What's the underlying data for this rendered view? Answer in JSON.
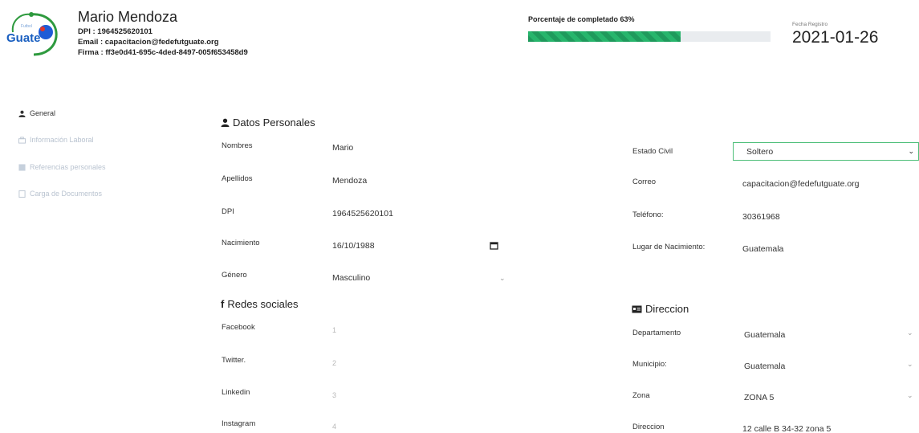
{
  "header": {
    "name": "Mario Mendoza",
    "dpi_label": "DPI :",
    "dpi_value": "1964525620101",
    "email_label": "Email :",
    "email_value": "capacitacion@fedefutguate.org",
    "firma_label": "Firma :",
    "firma_value": "ff3e0d41-695c-4ded-8497-005f653458d9",
    "logo_text": "Guate",
    "logo_small_text": "Futbol"
  },
  "progress": {
    "label": "Porcentaje de completado 63%",
    "percent": 63,
    "color": "#1f9a5c"
  },
  "registration": {
    "label": "Fecha Registro",
    "date": "2021-01-26"
  },
  "sidebar": {
    "items": [
      {
        "label": "General",
        "icon": "user-icon",
        "active": true
      },
      {
        "label": "Información Laboral",
        "icon": "briefcase-icon",
        "active": false
      },
      {
        "label": "Referencias personales",
        "icon": "users-icon",
        "active": false
      },
      {
        "label": "Carga de Documentos",
        "icon": "document-icon",
        "active": false
      }
    ]
  },
  "personal": {
    "title": "Datos Personales",
    "nombres_label": "Nombres",
    "nombres_value": "Mario",
    "apellidos_label": "Apellidos",
    "apellidos_value": "Mendoza",
    "dpi_label": "DPI",
    "dpi_value": "1964525620101",
    "nacimiento_label": "Nacimiento",
    "nacimiento_value": "16/10/1988",
    "genero_label": "Género",
    "genero_value": "Masculino",
    "estado_civil_label": "Estado Civil",
    "estado_civil_value": "Soltero",
    "correo_label": "Correo",
    "correo_value": "capacitacion@fedefutguate.org",
    "telefono_label": "Teléfono:",
    "telefono_value": "30361968",
    "lugar_label": "Lugar de Nacimiento:",
    "lugar_value": "Guatemala"
  },
  "social": {
    "title": "Redes sociales",
    "facebook_label": "Facebook",
    "facebook_value": "1",
    "twitter_label": "Twitter.",
    "twitter_value": "2",
    "linkedin_label": "Linkedin",
    "linkedin_value": "3",
    "instagram_label": "Instagram",
    "instagram_value": "4"
  },
  "address": {
    "title": "Direccion",
    "departamento_label": "Departamento",
    "departamento_value": "Guatemala",
    "municipio_label": "Municipio:",
    "municipio_value": "Guatemala",
    "zona_label": "Zona",
    "zona_value": "ZONA 5",
    "direccion_label": "Direccion",
    "direccion_value": "12 calle B 34-32 zona 5"
  }
}
